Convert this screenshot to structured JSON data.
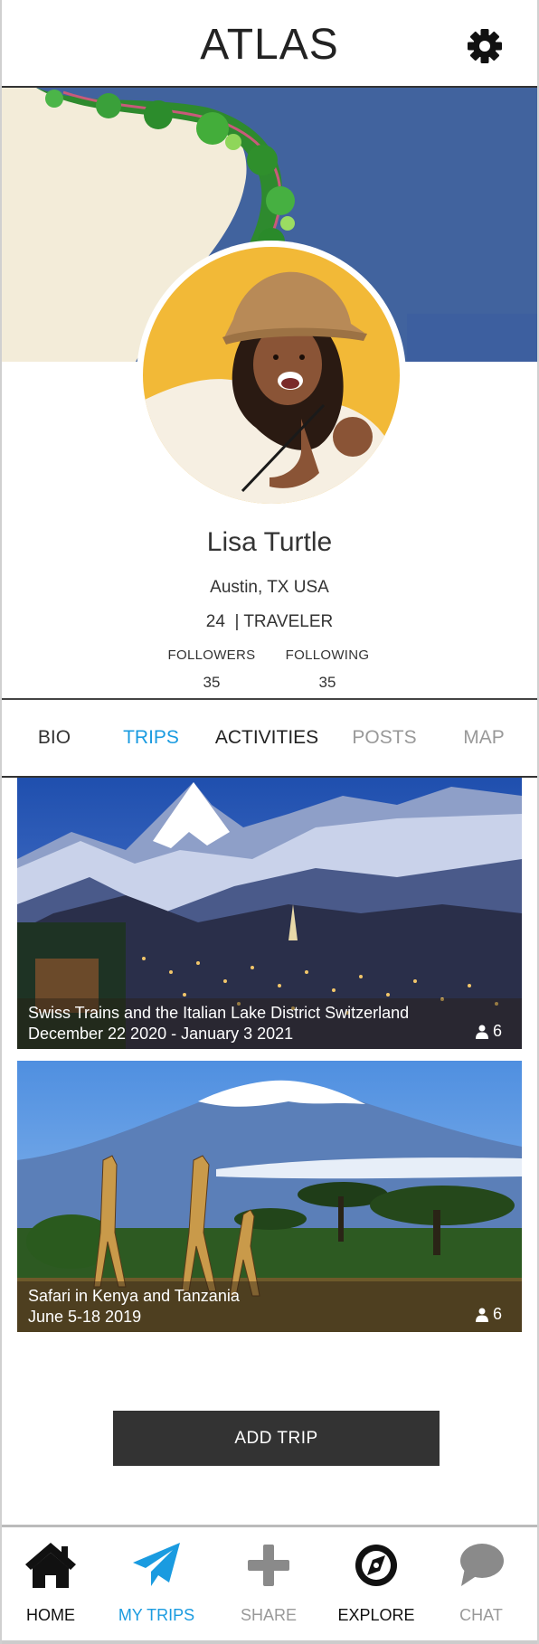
{
  "app": {
    "title": "ATLAS"
  },
  "profile": {
    "name": "Lisa Turtle",
    "location": "Austin, TX USA",
    "age": "24",
    "role": "| TRAVELER",
    "followers_label": "FOLLOWERS",
    "followers_count": "35",
    "following_label": "FOLLOWING",
    "following_count": "35"
  },
  "tabs": [
    {
      "label": "BIO",
      "state": "default"
    },
    {
      "label": "TRIPS",
      "state": "active"
    },
    {
      "label": "ACTIVITIES",
      "state": "default"
    },
    {
      "label": "POSTS",
      "state": "muted"
    },
    {
      "label": "MAP",
      "state": "muted"
    }
  ],
  "trips": [
    {
      "title": "Swiss Trains and the Italian Lake District Switzerland",
      "dates": "December 22 2020 - January 3 2021",
      "travelers": "6"
    },
    {
      "title": "Safari in Kenya and Tanzania",
      "dates": "June 5-18 2019",
      "travelers": "6"
    }
  ],
  "actions": {
    "add_trip": "ADD TRIP"
  },
  "bottom_nav": [
    {
      "label": "HOME",
      "icon": "home-icon"
    },
    {
      "label": "MY TRIPS",
      "icon": "paper-plane-icon",
      "active": true
    },
    {
      "label": "SHARE",
      "icon": "plus-icon"
    },
    {
      "label": "EXPLORE",
      "icon": "compass-icon"
    },
    {
      "label": "CHAT",
      "icon": "chat-bubble-icon"
    }
  ],
  "colors": {
    "accent": "#1a9be0",
    "dark": "#333333",
    "muted": "#999999"
  }
}
